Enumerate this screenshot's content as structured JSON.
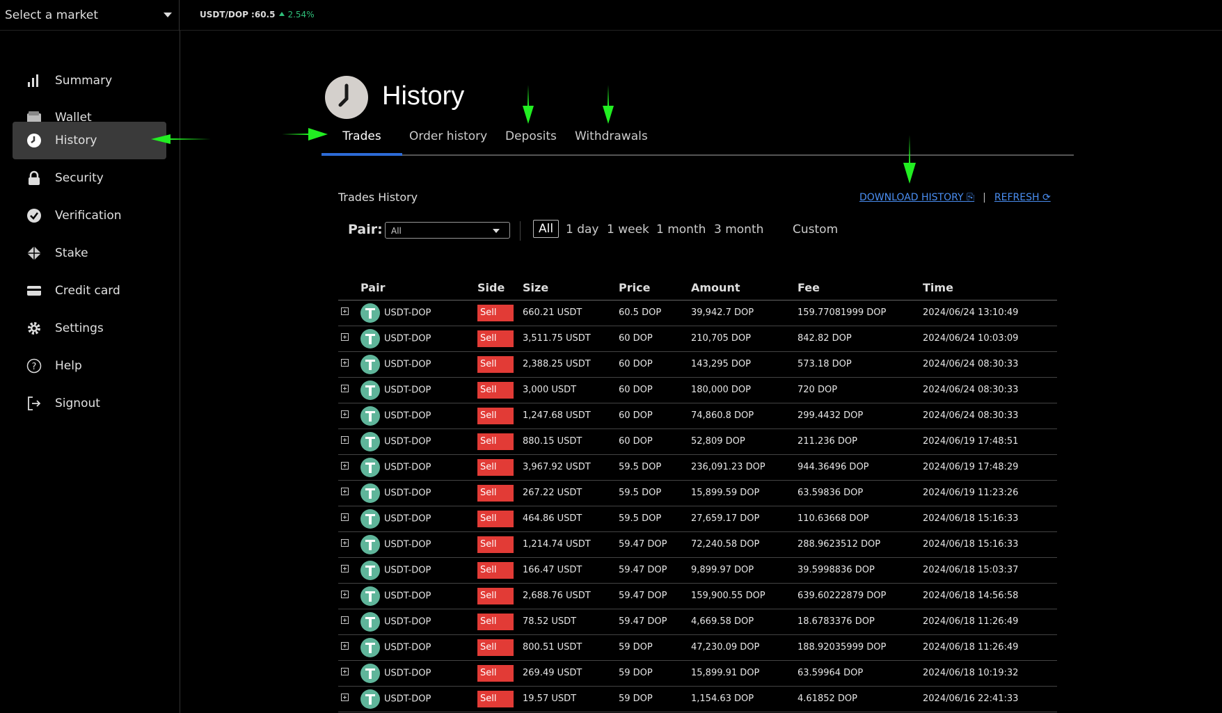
{
  "topbar": {
    "market_select": "Select a market",
    "ticker_pair": "USDT/DOP :60.5",
    "ticker_change": "2.54%"
  },
  "sidebar": {
    "items": [
      {
        "label": "Summary",
        "icon": "bar-chart-icon"
      },
      {
        "label": "Wallet",
        "icon": "wallet-icon"
      },
      {
        "label": "History",
        "icon": "clock-icon",
        "active": true
      },
      {
        "label": "Security",
        "icon": "lock-icon"
      },
      {
        "label": "Verification",
        "icon": "verified-badge-icon"
      },
      {
        "label": "Stake",
        "icon": "stake-cube-icon"
      },
      {
        "label": "Credit card",
        "icon": "credit-card-icon"
      },
      {
        "label": "Settings",
        "icon": "gear-icon"
      },
      {
        "label": "Help",
        "icon": "help-circle-icon"
      },
      {
        "label": "Signout",
        "icon": "signout-icon"
      }
    ]
  },
  "page": {
    "title": "History",
    "tabs": [
      {
        "label": "Trades",
        "active": true
      },
      {
        "label": "Order history"
      },
      {
        "label": "Deposits"
      },
      {
        "label": "Withdrawals"
      }
    ],
    "section_title": "Trades History",
    "download_label": "DOWNLOAD HISTORY",
    "refresh_label": "REFRESH"
  },
  "filters": {
    "pair_label": "Pair:",
    "pair_value": "All",
    "ranges": [
      {
        "label": "All",
        "active": true
      },
      {
        "label": "1 day"
      },
      {
        "label": "1 week"
      },
      {
        "label": "1 month"
      },
      {
        "label": "3 month"
      },
      {
        "label": "Custom"
      }
    ]
  },
  "table": {
    "headers": [
      "Pair",
      "Side",
      "Size",
      "Price",
      "Amount",
      "Fee",
      "Time"
    ],
    "rows": [
      [
        "USDT-DOP",
        "Sell",
        "660.21 USDT",
        "60.5 DOP",
        "39,942.7 DOP",
        "159.77081999 DOP",
        "2024/06/24 13:10:49"
      ],
      [
        "USDT-DOP",
        "Sell",
        "3,511.75 USDT",
        "60 DOP",
        "210,705 DOP",
        "842.82 DOP",
        "2024/06/24 10:03:09"
      ],
      [
        "USDT-DOP",
        "Sell",
        "2,388.25 USDT",
        "60 DOP",
        "143,295 DOP",
        "573.18 DOP",
        "2024/06/24 08:30:33"
      ],
      [
        "USDT-DOP",
        "Sell",
        "3,000 USDT",
        "60 DOP",
        "180,000 DOP",
        "720 DOP",
        "2024/06/24 08:30:33"
      ],
      [
        "USDT-DOP",
        "Sell",
        "1,247.68 USDT",
        "60 DOP",
        "74,860.8 DOP",
        "299.4432 DOP",
        "2024/06/24 08:30:33"
      ],
      [
        "USDT-DOP",
        "Sell",
        "880.15 USDT",
        "60 DOP",
        "52,809 DOP",
        "211.236 DOP",
        "2024/06/19 17:48:51"
      ],
      [
        "USDT-DOP",
        "Sell",
        "3,967.92 USDT",
        "59.5 DOP",
        "236,091.23 DOP",
        "944.36496 DOP",
        "2024/06/19 17:48:29"
      ],
      [
        "USDT-DOP",
        "Sell",
        "267.22 USDT",
        "59.5 DOP",
        "15,899.59 DOP",
        "63.59836 DOP",
        "2024/06/19 11:23:26"
      ],
      [
        "USDT-DOP",
        "Sell",
        "464.86 USDT",
        "59.5 DOP",
        "27,659.17 DOP",
        "110.63668 DOP",
        "2024/06/18 15:16:33"
      ],
      [
        "USDT-DOP",
        "Sell",
        "1,214.74 USDT",
        "59.47 DOP",
        "72,240.58 DOP",
        "288.9623512 DOP",
        "2024/06/18 15:16:33"
      ],
      [
        "USDT-DOP",
        "Sell",
        "166.47 USDT",
        "59.47 DOP",
        "9,899.97 DOP",
        "39.5998836 DOP",
        "2024/06/18 15:03:37"
      ],
      [
        "USDT-DOP",
        "Sell",
        "2,688.76 USDT",
        "59.47 DOP",
        "159,900.55 DOP",
        "639.60222879 DOP",
        "2024/06/18 14:56:58"
      ],
      [
        "USDT-DOP",
        "Sell",
        "78.52 USDT",
        "59.47 DOP",
        "4,669.58 DOP",
        "18.6783376 DOP",
        "2024/06/18 11:26:49"
      ],
      [
        "USDT-DOP",
        "Sell",
        "800.51 USDT",
        "59 DOP",
        "47,230.09 DOP",
        "188.92035999 DOP",
        "2024/06/18 11:26:49"
      ],
      [
        "USDT-DOP",
        "Sell",
        "269.49 USDT",
        "59 DOP",
        "15,899.91 DOP",
        "63.59964 DOP",
        "2024/06/18 10:19:32"
      ],
      [
        "USDT-DOP",
        "Sell",
        "19.57 USDT",
        "59 DOP",
        "1,154.63 DOP",
        "4.61852 DOP",
        "2024/06/16 22:41:33"
      ]
    ]
  },
  "colors": {
    "accent": "#2d6bd6",
    "sell": "#e23b36",
    "positive": "#2fbf7a",
    "annotation_arrow": "#22ee22"
  }
}
